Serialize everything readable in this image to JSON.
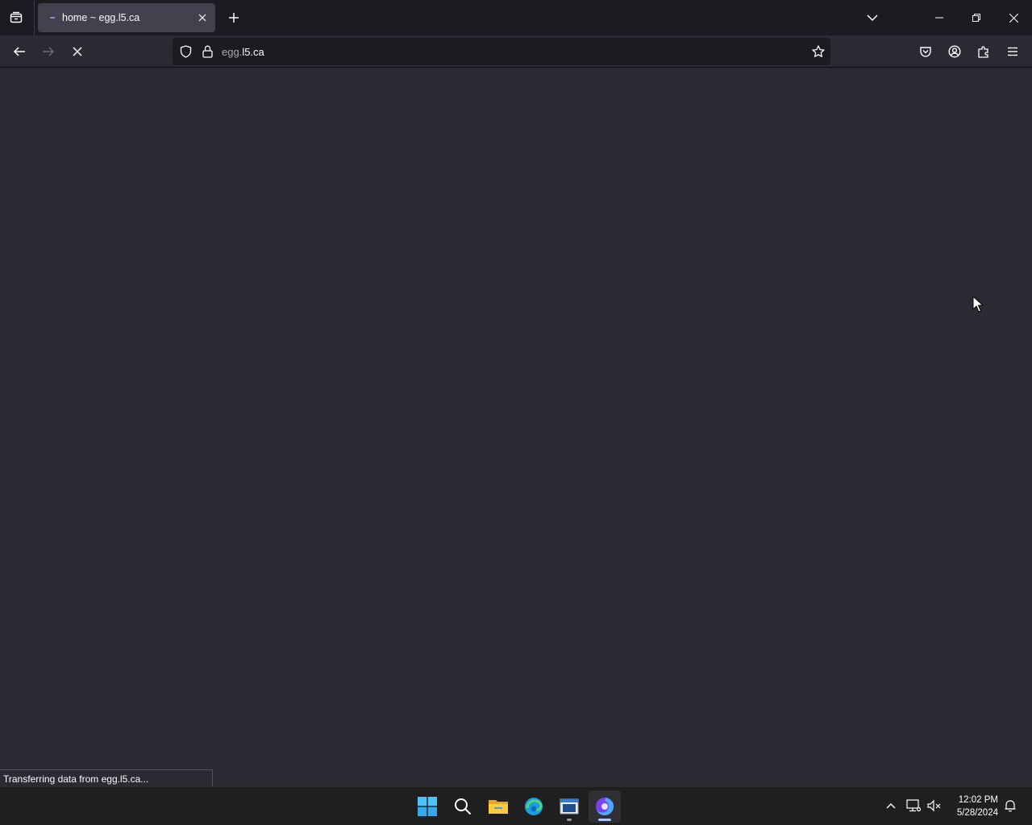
{
  "browser": {
    "tab": {
      "title": "home ~ egg.l5.ca"
    },
    "url": {
      "host_prefix": "egg.",
      "host_main": "l5.ca"
    },
    "status_text": "Transferring data from egg.l5.ca..."
  },
  "icons": {
    "tab_manager": "tab-manager-icon",
    "new_tab": "plus-icon",
    "tab_list": "chevron-down-icon",
    "back": "arrow-left-icon",
    "forward": "arrow-right-icon",
    "stop": "close-icon",
    "shield": "shield-icon",
    "lock": "lock-icon",
    "bookmark": "star-icon",
    "pocket": "pocket-icon",
    "account": "account-icon",
    "extensions": "puzzle-icon",
    "menu": "hamburger-menu-icon"
  },
  "taskbar": {
    "time": "12:02 PM",
    "date": "5/28/2024",
    "apps": [
      "Start",
      "Search",
      "File Explorer",
      "Microsoft Edge",
      "Notepad",
      "Firefox"
    ]
  },
  "colors": {
    "toolbar": "#2b2a33",
    "tabstrip": "#1c1b22",
    "active_tab": "#42414d",
    "urlbar": "#1c1b22",
    "taskbar": "#1f1f1f",
    "windows_blue": "#4cc2ff"
  }
}
